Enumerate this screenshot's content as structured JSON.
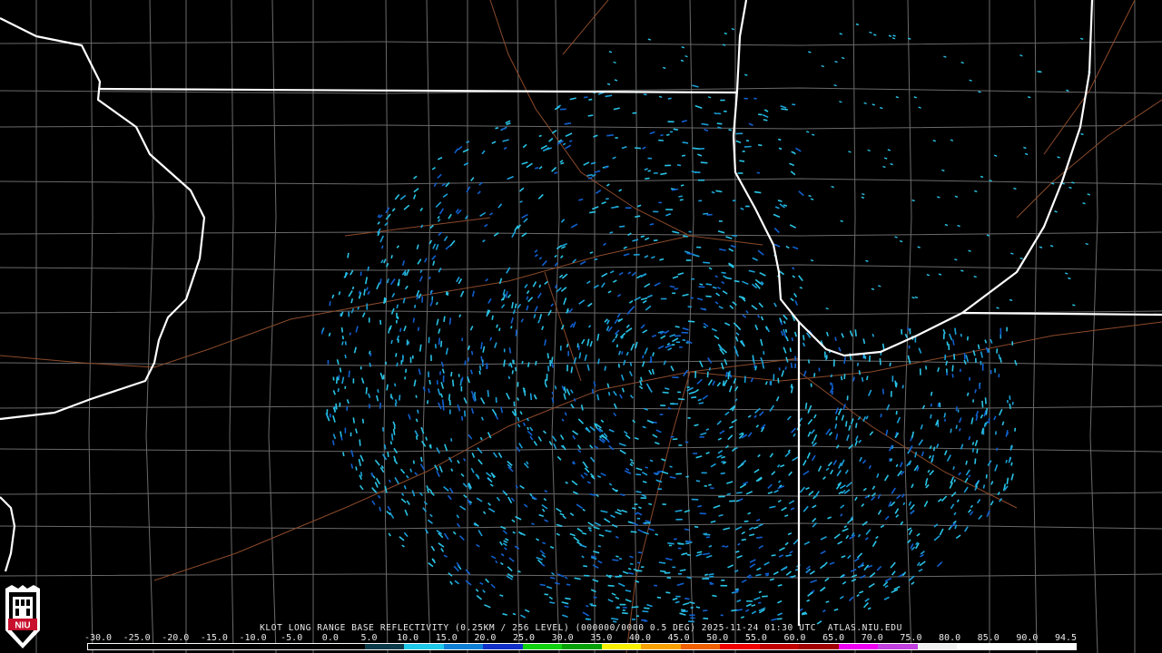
{
  "product": {
    "caption": "KLOT LONG RANGE BASE REFLECTIVITY (0.25KM / 256 LEVEL) (000000/0000 0.5 DEG) 2025-11-24 01:30 UTC  ATLAS.NIU.EDU",
    "logo_text": "NIU"
  },
  "scale": {
    "labels": [
      "-30.0",
      "-25.0",
      "-20.0",
      "-15.0",
      "-10.0",
      "-5.0",
      "0.0",
      "5.0",
      "10.0",
      "15.0",
      "20.0",
      "25.0",
      "30.0",
      "35.0",
      "40.0",
      "45.0",
      "50.0",
      "55.0",
      "60.0",
      "65.0",
      "70.0",
      "75.0",
      "80.0",
      "85.0",
      "90.0",
      "94.5"
    ],
    "colors": [
      "#000000",
      "#000000",
      "#000000",
      "#000000",
      "#000000",
      "#000000",
      "#000000",
      "#0b3a4a",
      "#1fc8e8",
      "#0f7fd6",
      "#1030c8",
      "#10d010",
      "#08a008",
      "#f8f000",
      "#f8a000",
      "#f06000",
      "#f00000",
      "#c00000",
      "#a00000",
      "#f000f0",
      "#c040e0",
      "#f0f0f0",
      "#ffffff",
      "#ffffff",
      "#ffffff"
    ]
  },
  "colors": {
    "background": "#000000",
    "state_border": "#ffffff",
    "county_line": "#6a6a6a",
    "highway": "#8b4a2a",
    "echo_light": "#29c4e6",
    "echo_mid": "#1aa0d8",
    "echo_dark": "#1060d0"
  },
  "icons": {
    "logo": "niu-logo-icon"
  }
}
